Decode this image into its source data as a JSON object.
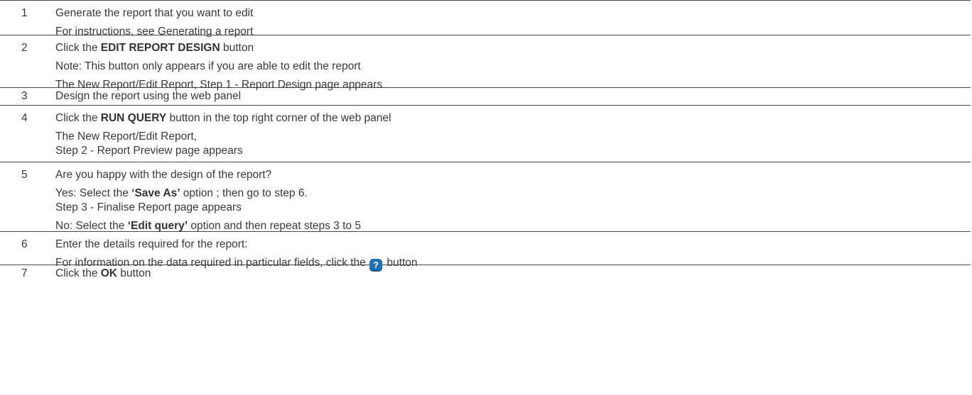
{
  "steps": [
    {
      "number": "1",
      "lines": [
        "Generate the report that you want to edit",
        "For instructions, see Generating a report"
      ]
    },
    {
      "number": "2",
      "line1_pre": "Click the ",
      "line1_bold": "EDIT REPORT DESIGN",
      "line1_post": " button",
      "line2": "Note: This button only appears if you are able to edit the report",
      "line3": "The New Report/Edit Report, Step 1 - Report Design page appears"
    },
    {
      "number": "3",
      "line1": "Design the report using the web panel"
    },
    {
      "number": "4",
      "line1_pre": "Click the ",
      "line1_bold": "RUN QUERY",
      "line1_post": " button in the top right corner of the web panel",
      "line2": "The New Report/Edit Report,",
      "line3": "Step 2 - Report Preview page appears"
    },
    {
      "number": "5",
      "line1": "Are you happy with the design of the report?",
      "line2_pre": "Yes: Select the ",
      "line2_bold": "‘Save As’",
      "line2_post": " option ; then go to step 6.",
      "line3": "Step 3 - Finalise Report page appears",
      "line4_pre": "No: Select the ",
      "line4_bold": "‘Edit query’",
      "line4_post": " option and then repeat steps 3 to 5"
    },
    {
      "number": "6",
      "line1": "Enter the details required for the report:",
      "line2_pre": "For information on the data required in particular fields, click the ",
      "line2_icon": "question-mark-help-icon",
      "line2_post": " button"
    },
    {
      "number": "7",
      "line1_pre": "Click the ",
      "line1_bold": "OK",
      "line1_post": " button"
    }
  ],
  "colors": {
    "text": "#3a3a3a",
    "rule": "#4a4a4a",
    "help_icon": "#1f6fb2"
  }
}
